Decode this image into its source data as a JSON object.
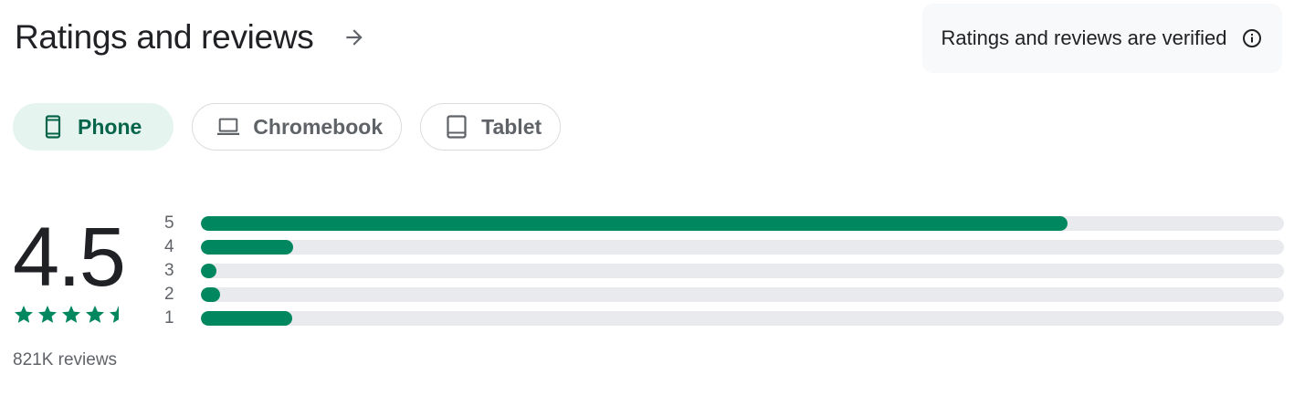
{
  "header": {
    "title": "Ratings and reviews",
    "arrow_icon": "arrow-forward-icon"
  },
  "verified": {
    "text": "Ratings and reviews are verified",
    "icon": "info-icon"
  },
  "device_chips": [
    {
      "label": "Phone",
      "icon": "phone-icon",
      "selected": true
    },
    {
      "label": "Chromebook",
      "icon": "laptop-icon",
      "selected": false
    },
    {
      "label": "Tablet",
      "icon": "tablet-icon",
      "selected": false
    }
  ],
  "summary": {
    "score": "4.5",
    "stars": 4.5,
    "reviews_count": "821K reviews"
  },
  "distribution": [
    {
      "label": "5",
      "fraction": 0.8
    },
    {
      "label": "4",
      "fraction": 0.085
    },
    {
      "label": "3",
      "fraction": 0.013
    },
    {
      "label": "2",
      "fraction": 0.018
    },
    {
      "label": "1",
      "fraction": 0.084
    }
  ],
  "colors": {
    "accent": "#01875f",
    "chip_selected_bg": "#e6f4ef",
    "track": "#e8eaed"
  }
}
